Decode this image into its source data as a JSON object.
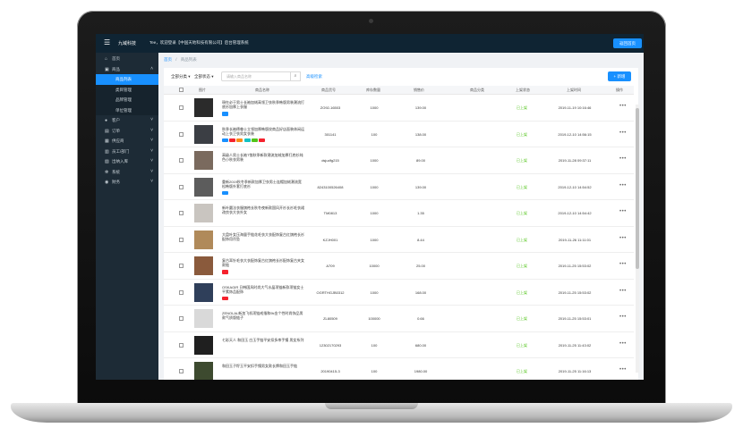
{
  "header": {
    "brand": "九域科技",
    "welcome": "Tee，欢迎登录【中国天地科技有限公司】后台管理系统",
    "login_button": "返回首页",
    "menu_icon": "hamburger-icon"
  },
  "sidebar": {
    "items": [
      {
        "label": "首页",
        "icon": "home-icon"
      },
      {
        "label": "商品",
        "icon": "goods-icon"
      },
      {
        "label": "商品列表",
        "sub": true,
        "active": true
      },
      {
        "label": "类目管理",
        "sub": true
      },
      {
        "label": "品牌管理",
        "sub": true
      },
      {
        "label": "单位管理",
        "sub": true
      },
      {
        "label": "客户",
        "icon": "user-icon"
      },
      {
        "label": "订单",
        "icon": "order-icon"
      },
      {
        "label": "供应商",
        "icon": "supplier-icon"
      },
      {
        "label": "员工/部门",
        "icon": "staff-icon"
      },
      {
        "label": "出纳入库",
        "icon": "stock-icon"
      },
      {
        "label": "系统",
        "icon": "gear-icon"
      },
      {
        "label": "财务",
        "icon": "finance-icon"
      }
    ]
  },
  "breadcrumb": {
    "home": "首页",
    "sep": "/",
    "current": "商品列表"
  },
  "filters": {
    "category": "全部分类",
    "status": "全部状态",
    "search_placeholder": "请输入商品名称",
    "advanced": "高级检索",
    "add_button": "新增"
  },
  "columns": [
    "图片",
    "商品名称",
    "商品货号",
    "库存数量",
    "销售价",
    "商品分类",
    "上架状态",
    "上架时间",
    "操作"
  ],
  "rows": [
    {
      "name": "現在必于男士长袖加绒高领卫衣秋季韩版男装潮流打底衫加厚上衣服",
      "sku": "ZO92-16503",
      "stock": "1000",
      "price": "139.00",
      "status": "已上架",
      "time": "2019-11-19 10:16:46",
      "tags": [
        "#1890ff"
      ]
    },
    {
      "name": "秋季长袖德尊士立领加厚韩版纹商品好店面装休闲运动上衣卫衣男女衣装",
      "sku": "301141",
      "stock": "100",
      "price": "138.00",
      "status": "已上架",
      "time": "2019-12-10 14:56:15",
      "tags": [
        "#1890ff",
        "#f5222d",
        "#fa8c16",
        "#13c2c2",
        "#52c41a",
        "#f5222d"
      ]
    },
    {
      "name": "高级人男士长袖T恤秋季新款潮流加绒加厚打底衫纯色小秋衣男装",
      "sku": "dsjudfg215",
      "stock": "1000",
      "price": "89.00",
      "status": "已上架",
      "time": "2019-11-28 09:37:11",
      "tags": []
    },
    {
      "name": "重新2019秋冬季新款加厚卫衣男士连帽加绒潮流宽松韩版外套打底衫",
      "sku": "8243100526408",
      "stock": "1000",
      "price": "139.00",
      "status": "已上架",
      "time": "2019-12-10 14:54:52",
      "tags": [
        "#1890ff"
      ]
    },
    {
      "name": "新叶圆法衣服旗袍长秋冬夜新款国风开衫长衫毛衣裙改良衣大衣外女",
      "sku": "TM0813",
      "stock": "1000",
      "price": "1.35",
      "status": "已上架",
      "time": "2019-12-10 14:54:42",
      "tags": []
    },
    {
      "name": "大盘叶女压海量手链花毛衣大衣配饰复古红旗袍长衫配饰用吊坠",
      "sku": "KZJH001",
      "stock": "1000",
      "price": "8.44",
      "status": "已上架",
      "time": "2019-11-26 11:11:01",
      "tags": []
    },
    {
      "name": "复古耳针毛衣大衣配饰复古红旗袍长衫配饰复古夹女款链",
      "sku": "A709",
      "stock": "10000",
      "price": "25.00",
      "status": "已上架",
      "time": "2019-11-25 15:53:02",
      "tags": [
        "#f5222d"
      ]
    },
    {
      "name": "OSKAGIR 日韩国风时尚大气水晶项链新款项链女士平素饰品配饰",
      "sku": "OGRTHGJB0312",
      "stock": "1000",
      "price": "168.00",
      "status": "已上架",
      "time": "2019-11-25 15:53:02",
      "tags": [
        "#f5222d"
      ]
    },
    {
      "name": "ZENOLAL新加飞机项链戒指和9k金个性时尚饰品男款气质版链子",
      "sku": "ZL80509",
      "stock": "100000",
      "price": "0.66",
      "status": "已上架",
      "time": "2019-11-25 15:53:01",
      "tags": []
    },
    {
      "name": "七彩天人 和田玉 白玉手链平安扣多串手镯 男女系列",
      "sku": "12302170293",
      "stock": "100",
      "price": "680.00",
      "status": "已上架",
      "time": "2019-11-25 11:43:02",
      "tags": []
    },
    {
      "name": "和田玉子籽玉平安扣手镯男女款长牌和田玉手链",
      "sku": "20190415-3",
      "stock": "100",
      "price": "1980.00",
      "status": "已上架",
      "time": "2019-11-25 11:16:13",
      "tags": []
    }
  ],
  "actions_glyph": "•••",
  "colors": {
    "accent": "#1890ff",
    "sidebar_bg": "#1d2b36",
    "topbar_bg": "#0f2433",
    "status": "#52c41a"
  }
}
